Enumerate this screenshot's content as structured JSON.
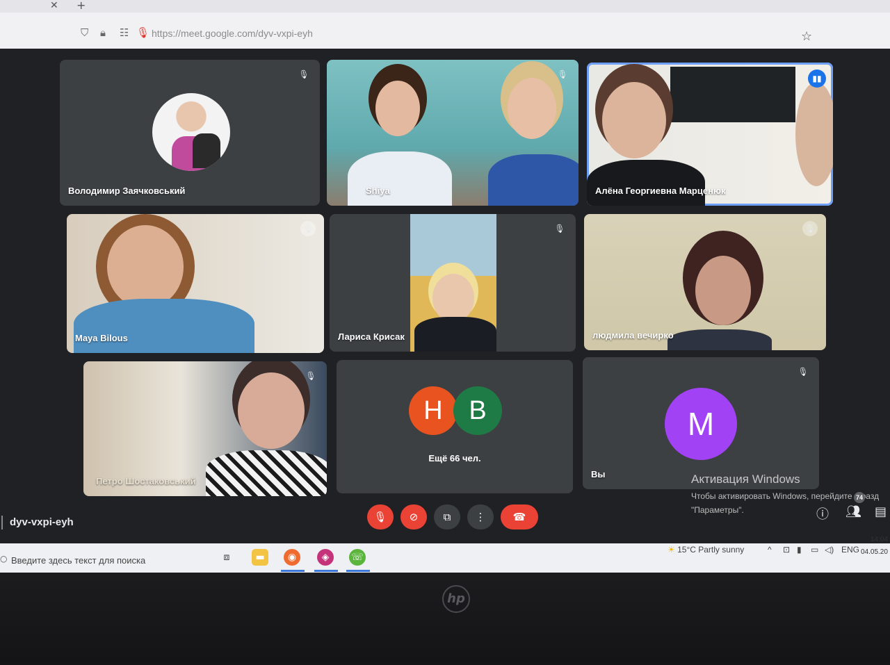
{
  "browser": {
    "url": "https://meet.google.com/dyv-vxpi-eyh",
    "tab_close": "✕",
    "new_tab": "+"
  },
  "tiles": [
    {
      "name": "Володимир Заячковський",
      "muted": true
    },
    {
      "name": "Shiya",
      "muted": true
    },
    {
      "name": "Алёна Георгиевна Марценюк",
      "speaking": true
    },
    {
      "name": "Maya Bilous",
      "muted": true
    },
    {
      "name": "Лариса Крисак",
      "muted": true
    },
    {
      "name": "людмила вечирко",
      "muted": true
    },
    {
      "name": "Петро Шостаковський",
      "muted": true
    },
    {
      "name": "",
      "more": "Ещё 66 чел.",
      "avatars": [
        {
          "letter": "Н",
          "color": "#e8531f"
        },
        {
          "letter": "В",
          "color": "#1e7b45"
        }
      ]
    },
    {
      "name": "Вы",
      "avatar": {
        "letter": "M",
        "color": "#a142f4"
      },
      "muted": true
    }
  ],
  "meeting_code": "dyv-vxpi-eyh",
  "controls": {
    "mic": "mic-off",
    "camera": "camera-off",
    "present": "present",
    "more": "more",
    "hangup": "hang-up"
  },
  "activation": {
    "title": "Активация Windows",
    "line1": "Чтобы активировать Windows, перейдите в разд",
    "line2": "\"Параметры\"."
  },
  "participants_count": "74",
  "taskbar": {
    "search_placeholder": "Введите здесь текст для поиска",
    "weather": "15°C  Partly sunny",
    "lang": "ENG",
    "time": "14:04",
    "date": "04.05.20"
  },
  "colors": {
    "meet_bg": "#202124",
    "tile_bg": "#3c4043",
    "danger": "#ea4335",
    "speaking": "#6f9ff5"
  }
}
